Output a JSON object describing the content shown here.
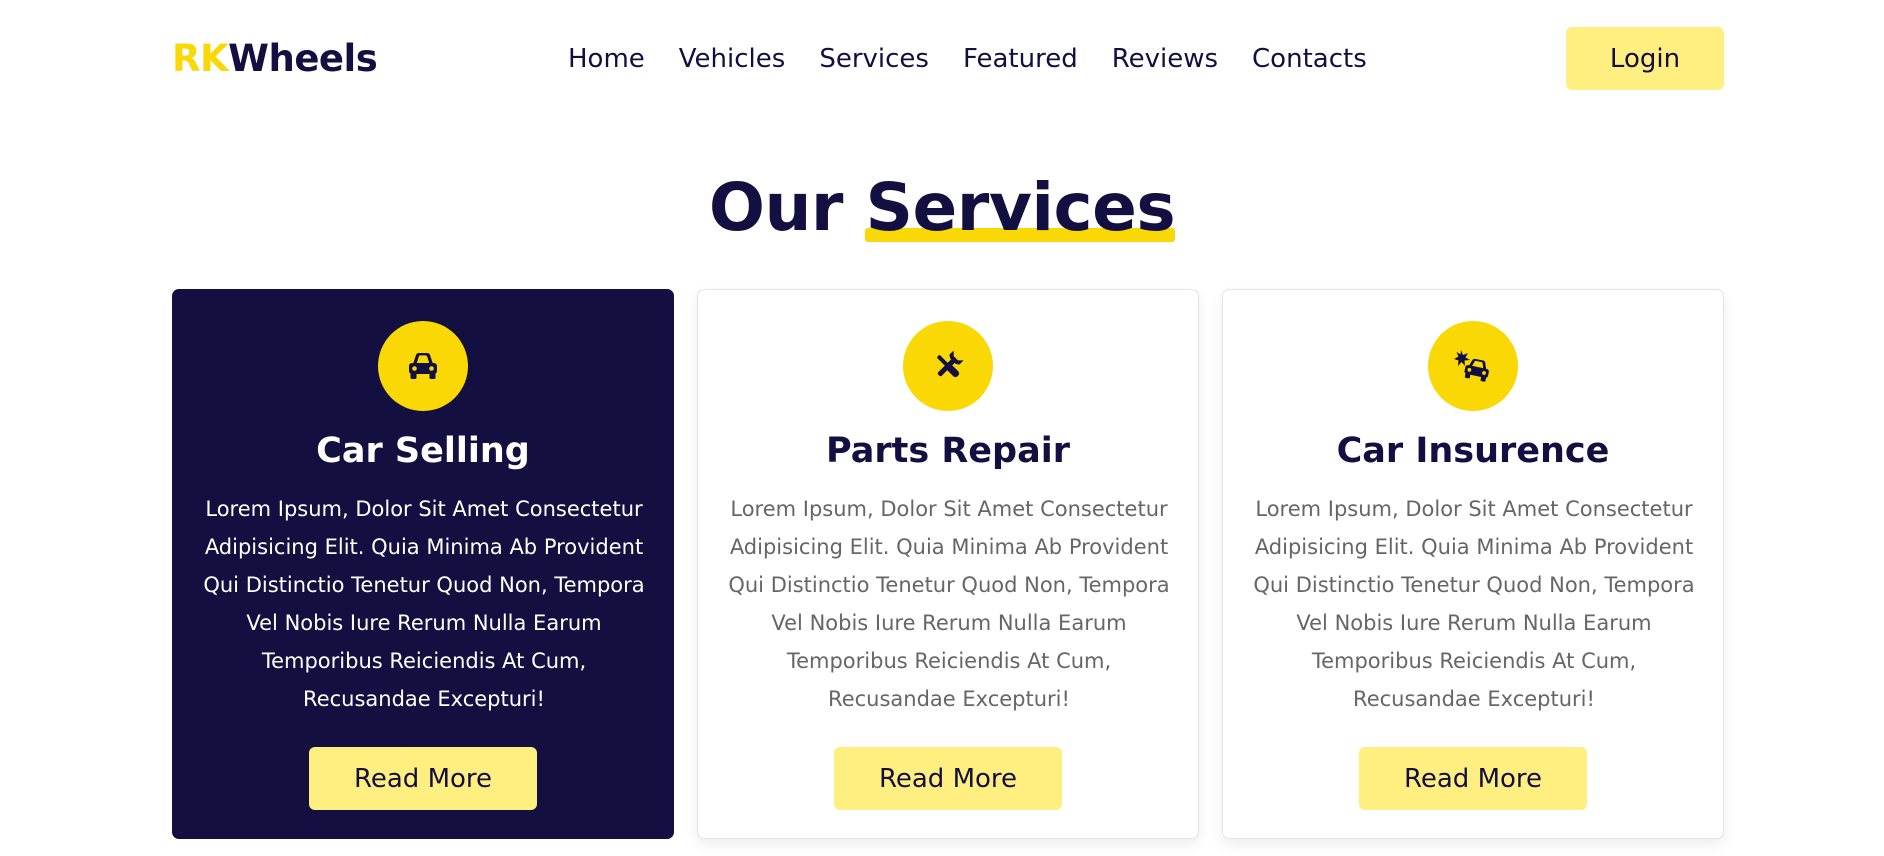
{
  "header": {
    "logo_accent": "RK",
    "logo_main": "Wheels",
    "nav": [
      {
        "label": "Home"
      },
      {
        "label": "Vehicles"
      },
      {
        "label": "Services"
      },
      {
        "label": "Featured"
      },
      {
        "label": "Reviews"
      },
      {
        "label": "Contacts"
      }
    ],
    "login_label": "Login"
  },
  "section": {
    "heading_plain": "Our",
    "heading_highlight": "Services"
  },
  "services": [
    {
      "icon": "car-icon",
      "title": "Car Selling",
      "description": "Lorem Ipsum, Dolor Sit Amet Consectetur Adipisicing Elit. Quia Minima Ab Provident Qui Distinctio Tenetur Quod Non, Tempora Vel Nobis Iure Rerum Nulla Earum Temporibus Reiciendis At Cum, Recusandae Excepturi!",
      "button_label": "Read More",
      "active": true
    },
    {
      "icon": "tools-icon",
      "title": "Parts Repair",
      "description": "Lorem Ipsum, Dolor Sit Amet Consectetur Adipisicing Elit. Quia Minima Ab Provident Qui Distinctio Tenetur Quod Non, Tempora Vel Nobis Iure Rerum Nulla Earum Temporibus Reiciendis At Cum, Recusandae Excepturi!",
      "button_label": "Read More",
      "active": false
    },
    {
      "icon": "car-crash-icon",
      "title": "Car Insurence",
      "description": "Lorem Ipsum, Dolor Sit Amet Consectetur Adipisicing Elit. Quia Minima Ab Provident Qui Distinctio Tenetur Quod Non, Tempora Vel Nobis Iure Rerum Nulla Earum Temporibus Reiciendis At Cum, Recusandae Excepturi!",
      "button_label": "Read More",
      "active": false
    }
  ],
  "colors": {
    "primary": "#130f40",
    "accent": "#f9d806",
    "button": "#ffee80",
    "text_muted": "#666666"
  }
}
